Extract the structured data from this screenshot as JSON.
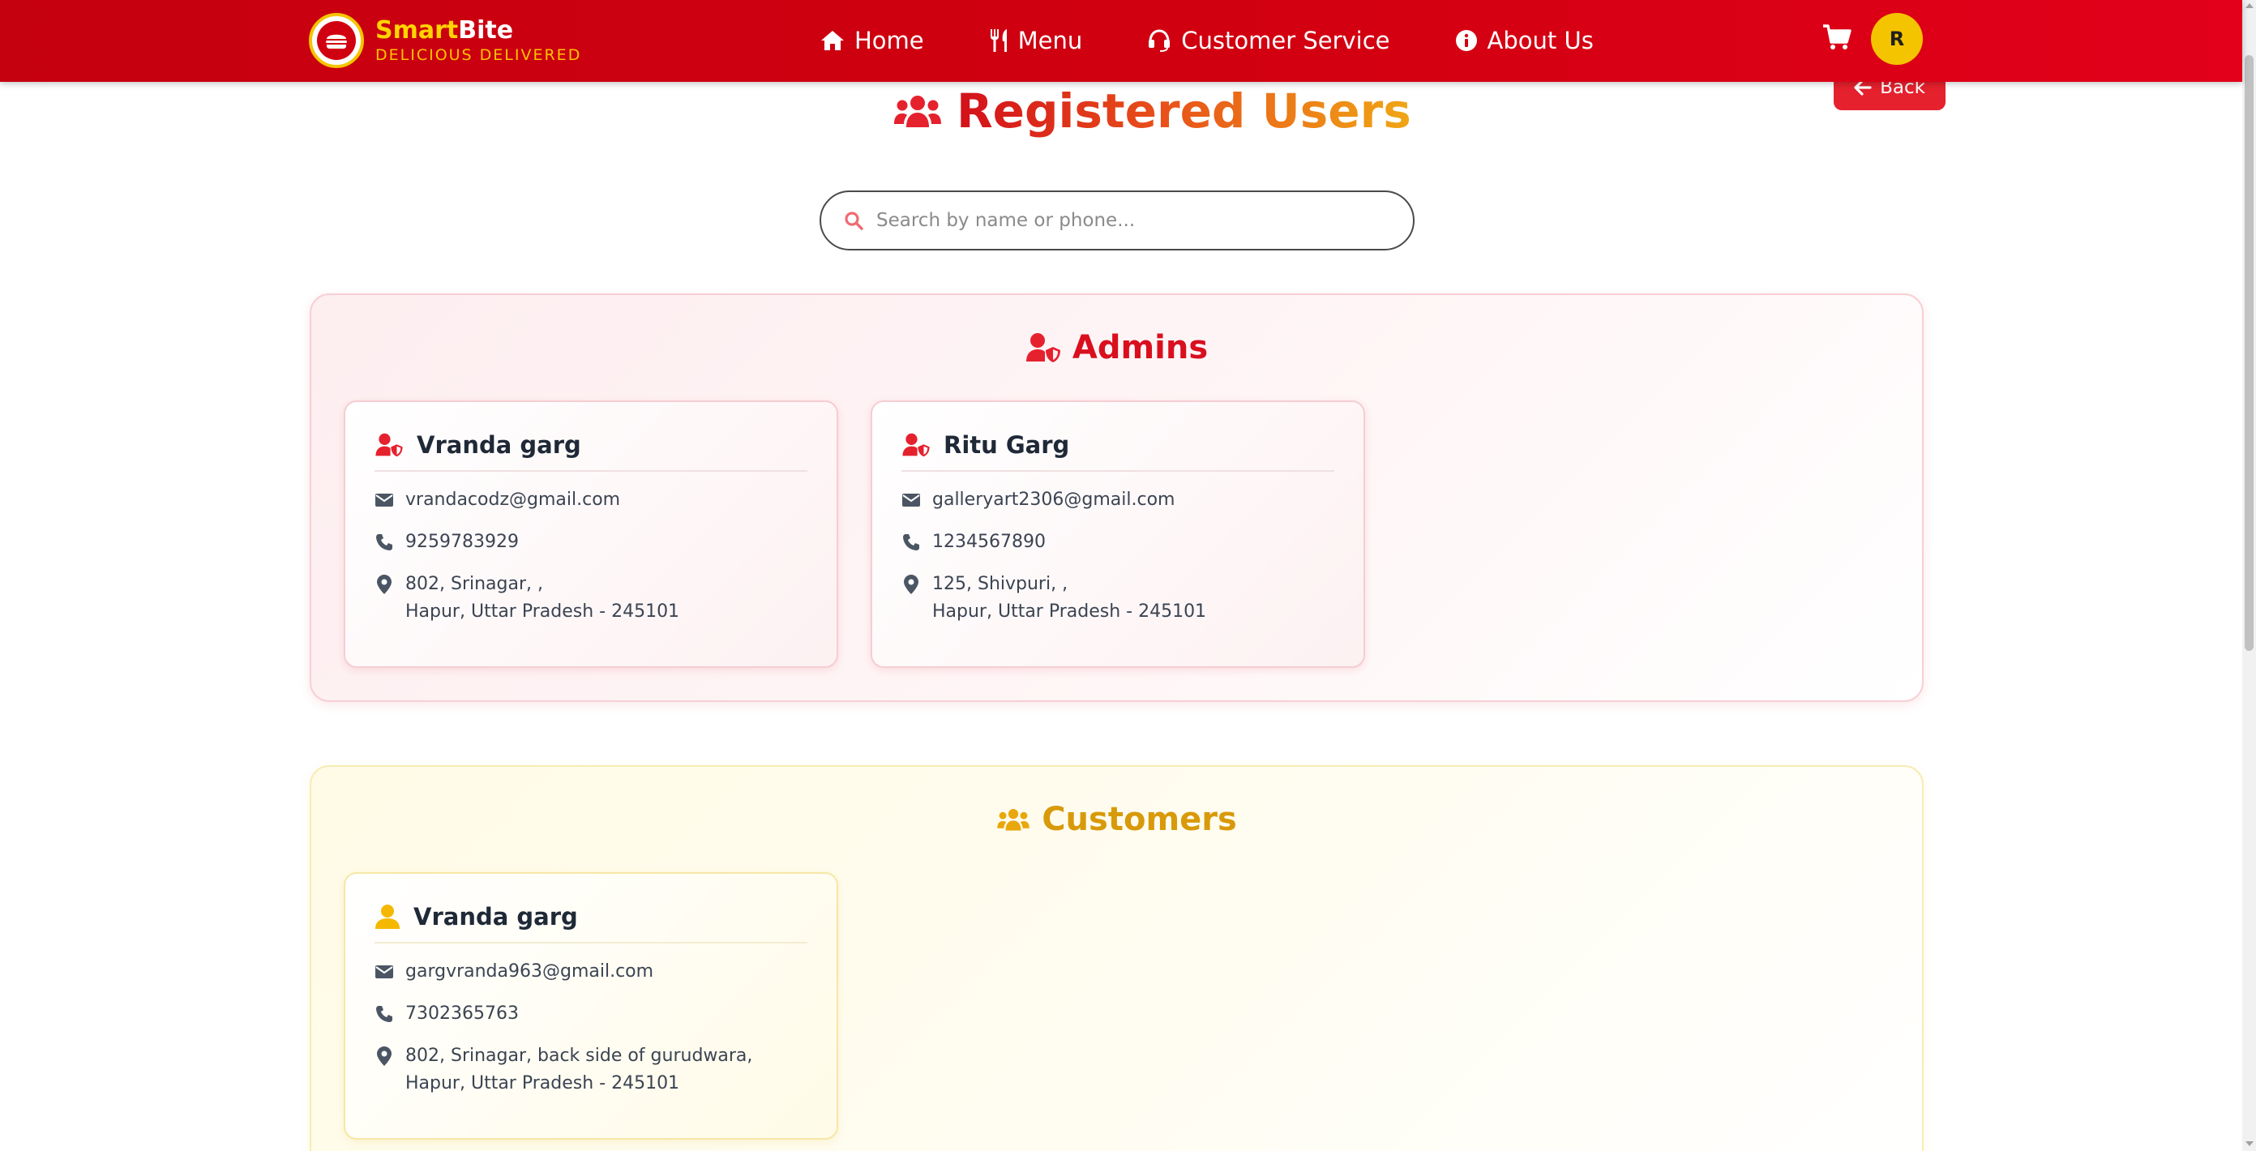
{
  "brand": {
    "name_part1": "Smart",
    "name_part2": "Bite",
    "tagline": "DELICIOUS DELIVERED"
  },
  "nav": {
    "home": "Home",
    "menu": "Menu",
    "customer_service": "Customer Service",
    "about": "About Us",
    "avatar_initial": "R"
  },
  "page": {
    "back_label": "Back",
    "title": "Registered Users",
    "search_placeholder": "Search by name or phone..."
  },
  "admins": {
    "title": "Admins",
    "users": [
      {
        "name": "Vranda garg",
        "email": "vrandacodz@gmail.com",
        "phone": "9259783929",
        "address_line1": "802, Srinagar, ,",
        "address_line2": "Hapur, Uttar Pradesh - 245101"
      },
      {
        "name": "Ritu Garg",
        "email": "galleryart2306@gmail.com",
        "phone": "1234567890",
        "address_line1": "125, Shivpuri, ,",
        "address_line2": "Hapur, Uttar Pradesh - 245101"
      }
    ]
  },
  "customers": {
    "title": "Customers",
    "users": [
      {
        "name": "Vranda garg",
        "email": "gargvranda963@gmail.com",
        "phone": "7302365763",
        "address_line1": "802, Srinagar, back side of gurudwara,",
        "address_line2": "Hapur, Uttar Pradesh - 245101"
      }
    ]
  },
  "colors": {
    "navbar": "#d10010",
    "accent_red": "#d90f1f",
    "accent_gold": "#f5c400",
    "customers_title": "#d89a0a"
  },
  "icons": [
    "burger-logo-icon",
    "home-icon",
    "utensils-icon",
    "headset-icon",
    "info-icon",
    "cart-icon",
    "arrow-left-icon",
    "users-icon",
    "search-icon",
    "user-shield-icon",
    "user-icon",
    "envelope-icon",
    "phone-icon",
    "map-pin-icon"
  ]
}
